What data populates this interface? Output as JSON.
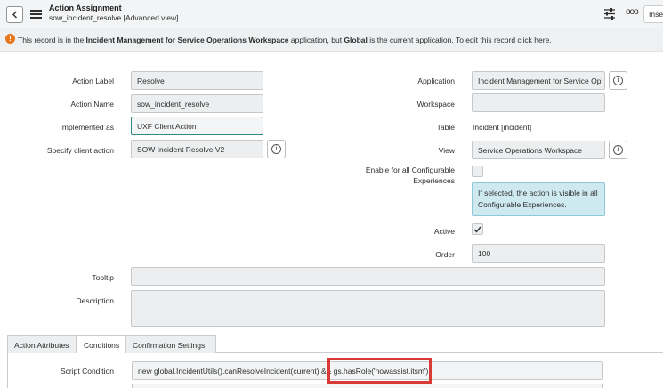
{
  "header": {
    "title": "Action Assignment",
    "subtitle": "sow_incident_resolve [Advanced view]",
    "insert_label": "Inse"
  },
  "banner": {
    "part1": "This record is in the ",
    "app_name": "Incident Management for Service Operations Workspace",
    "part2": " application, but ",
    "scope": "Global",
    "part3": " is the current application. To edit this record click ",
    "link": "here",
    "part4": "."
  },
  "form": {
    "action_label": {
      "label": "Action Label",
      "value": "Resolve"
    },
    "action_name": {
      "label": "Action Name",
      "value": "sow_incident_resolve"
    },
    "implemented_as": {
      "label": "Implemented as",
      "value": "UXF Client Action"
    },
    "client_action": {
      "label": "Specify client action",
      "value": "SOW Incident Resolve V2"
    },
    "application": {
      "label": "Application",
      "value": "Incident Management for Service Op"
    },
    "workspace": {
      "label": "Workspace",
      "value": ""
    },
    "table": {
      "label": "Table",
      "value": "Incident [incident]"
    },
    "view": {
      "label": "View",
      "value": "Service Operations Workspace"
    },
    "enable_all": {
      "label_line1": "Enable for all Configurable",
      "label_line2": "Experiences",
      "checked": false
    },
    "enable_hint": "If selected, the action is visible in all Configurable Experiences.",
    "active": {
      "label": "Active",
      "checked": true
    },
    "order": {
      "label": "Order",
      "value": "100"
    },
    "tooltip": {
      "label": "Tooltip",
      "value": ""
    },
    "description": {
      "label": "Description",
      "value": ""
    }
  },
  "tabs": [
    {
      "label": "Action Attributes",
      "active": false
    },
    {
      "label": "Conditions",
      "active": true
    },
    {
      "label": "Confirmation Settings",
      "active": false
    }
  ],
  "conditions": {
    "script_label": "Script Condition",
    "script_value": "new global.IncidentUtils().canResolveIncident(current) && gs.hasRole('nowassist.itsm')"
  },
  "colors": {
    "accent": "#2f8a7d",
    "warning": "#e8761c",
    "highlight": "#d83b35",
    "hint_bg": "#cfe9f0"
  },
  "icons": {
    "back": "chevron-left-icon",
    "menu": "hamburger-icon",
    "settings": "sliders-icon",
    "more": "more-icon",
    "warning": "exclamation-icon",
    "info": "info-icon",
    "check": "checkmark-icon"
  }
}
